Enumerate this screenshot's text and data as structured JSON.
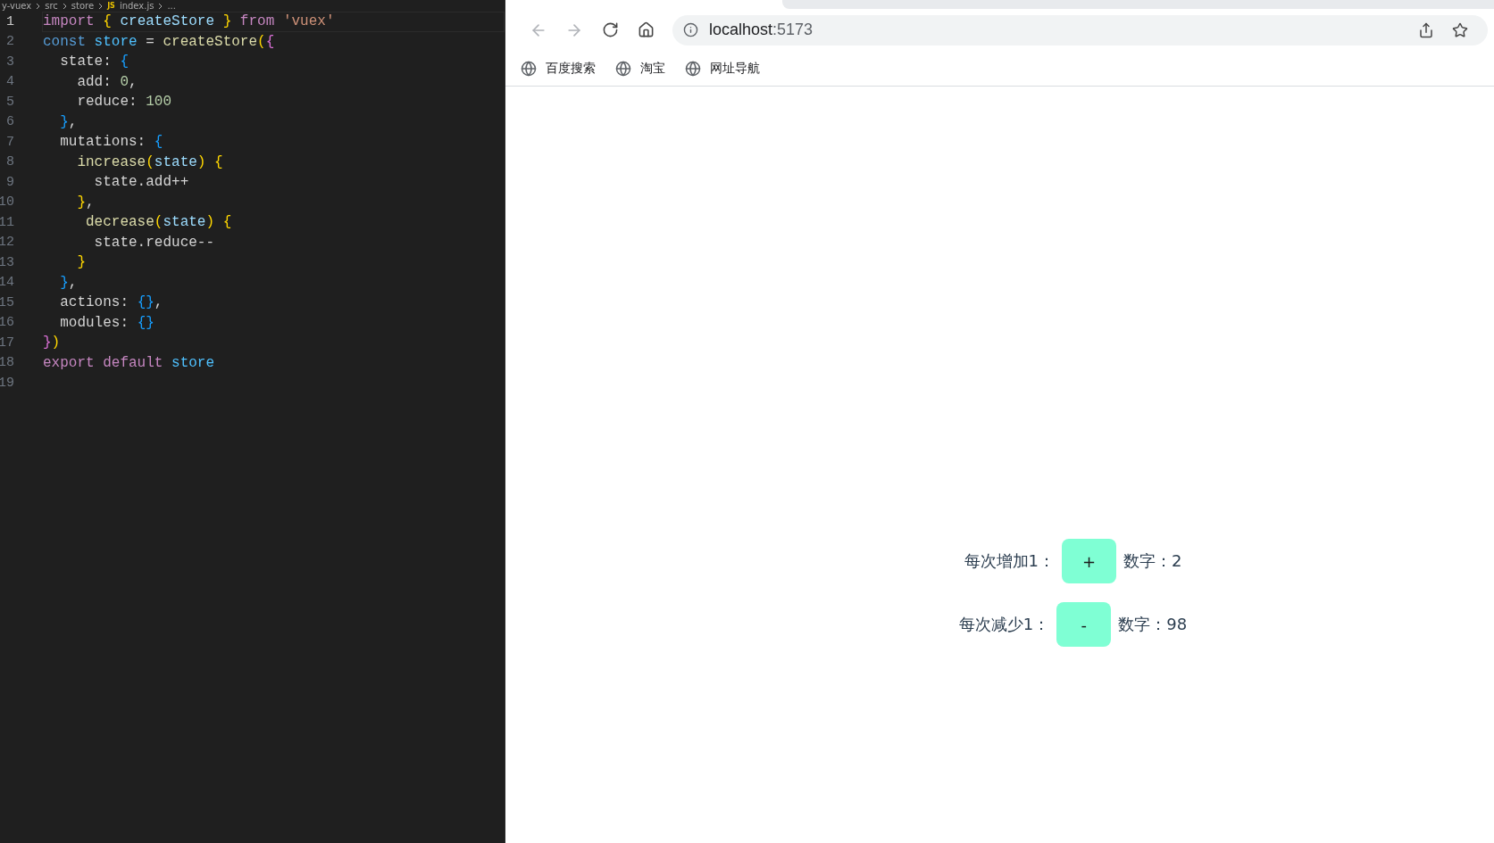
{
  "editor": {
    "breadcrumb": [
      "y-vuex",
      "src",
      "store",
      "index.js",
      "..."
    ],
    "file_badge": "JS",
    "lines": [
      {
        "number": "1",
        "selected": true,
        "tokens": [
          {
            "t": "import ",
            "kind": "keyword"
          },
          {
            "t": "{",
            "kind": "b1"
          },
          {
            "t": " createStore ",
            "kind": "var"
          },
          {
            "t": "}",
            "kind": "b1"
          },
          {
            "t": " from ",
            "kind": "keyword"
          },
          {
            "t": "'vuex'",
            "kind": "string"
          }
        ]
      },
      {
        "number": "2",
        "selected": false,
        "tokens": [
          {
            "t": "const ",
            "kind": "storage"
          },
          {
            "t": "store",
            "kind": "const"
          },
          {
            "t": " = ",
            "kind": "plain"
          },
          {
            "t": "createStore",
            "kind": "func"
          },
          {
            "t": "(",
            "kind": "b1"
          },
          {
            "t": "{",
            "kind": "b2"
          }
        ]
      },
      {
        "number": "3",
        "selected": false,
        "tokens": [
          {
            "t": "  state: ",
            "kind": "plain"
          },
          {
            "t": "{",
            "kind": "b3"
          }
        ]
      },
      {
        "number": "4",
        "selected": false,
        "tokens": [
          {
            "t": "    add: ",
            "kind": "plain"
          },
          {
            "t": "0",
            "kind": "number"
          },
          {
            "t": ",",
            "kind": "plain"
          }
        ]
      },
      {
        "number": "5",
        "selected": false,
        "tokens": [
          {
            "t": "    reduce: ",
            "kind": "plain"
          },
          {
            "t": "100",
            "kind": "number"
          }
        ]
      },
      {
        "number": "6",
        "selected": false,
        "tokens": [
          {
            "t": "  }",
            "kind": "b3"
          },
          {
            "t": ",",
            "kind": "plain"
          }
        ]
      },
      {
        "number": "7",
        "selected": false,
        "tokens": [
          {
            "t": "  mutations: ",
            "kind": "plain"
          },
          {
            "t": "{",
            "kind": "b3"
          }
        ]
      },
      {
        "number": "8",
        "selected": false,
        "tokens": [
          {
            "t": "    increase",
            "kind": "func"
          },
          {
            "t": "(",
            "kind": "b1"
          },
          {
            "t": "state",
            "kind": "var"
          },
          {
            "t": ") {",
            "kind": "b1"
          }
        ]
      },
      {
        "number": "9",
        "selected": false,
        "tokens": [
          {
            "t": "      state.add++",
            "kind": "plain"
          }
        ]
      },
      {
        "number": "10",
        "selected": false,
        "tokens": [
          {
            "t": "    }",
            "kind": "b1"
          },
          {
            "t": ",",
            "kind": "plain"
          }
        ]
      },
      {
        "number": "11",
        "selected": false,
        "tokens": [
          {
            "t": "     decrease",
            "kind": "func"
          },
          {
            "t": "(",
            "kind": "b1"
          },
          {
            "t": "state",
            "kind": "var"
          },
          {
            "t": ") {",
            "kind": "b1"
          }
        ]
      },
      {
        "number": "12",
        "selected": false,
        "tokens": [
          {
            "t": "      state.reduce--",
            "kind": "plain"
          }
        ]
      },
      {
        "number": "13",
        "selected": false,
        "tokens": [
          {
            "t": "    }",
            "kind": "b1"
          }
        ]
      },
      {
        "number": "14",
        "selected": false,
        "tokens": [
          {
            "t": "  }",
            "kind": "b3"
          },
          {
            "t": ",",
            "kind": "plain"
          }
        ]
      },
      {
        "number": "15",
        "selected": false,
        "tokens": [
          {
            "t": "  actions: ",
            "kind": "plain"
          },
          {
            "t": "{}",
            "kind": "b3"
          },
          {
            "t": ",",
            "kind": "plain"
          }
        ]
      },
      {
        "number": "16",
        "selected": false,
        "tokens": [
          {
            "t": "  modules: ",
            "kind": "plain"
          },
          {
            "t": "{}",
            "kind": "b3"
          }
        ]
      },
      {
        "number": "17",
        "selected": false,
        "tokens": [
          {
            "t": "}",
            "kind": "b2"
          },
          {
            "t": ")",
            "kind": "b1"
          }
        ]
      },
      {
        "number": "18",
        "selected": false,
        "tokens": [
          {
            "t": "export default ",
            "kind": "keyword"
          },
          {
            "t": "store",
            "kind": "const"
          }
        ]
      },
      {
        "number": "19",
        "selected": false
      }
    ]
  },
  "browser": {
    "nav": [
      {
        "kind": "back",
        "disabled": true
      },
      {
        "kind": "forward",
        "disabled": true
      },
      {
        "kind": "reload",
        "disabled": false
      },
      {
        "kind": "home",
        "disabled": false
      }
    ],
    "address": {
      "host": "localhost",
      "port": ":5173"
    },
    "bookmarks": [
      "百度搜索",
      "淘宝",
      "网址导航"
    ],
    "counters": [
      {
        "label": "每次增加1：",
        "button": "+",
        "result": "数字：2"
      },
      {
        "label": "每次减少1：",
        "button": "-",
        "result": "数字：98"
      }
    ]
  }
}
